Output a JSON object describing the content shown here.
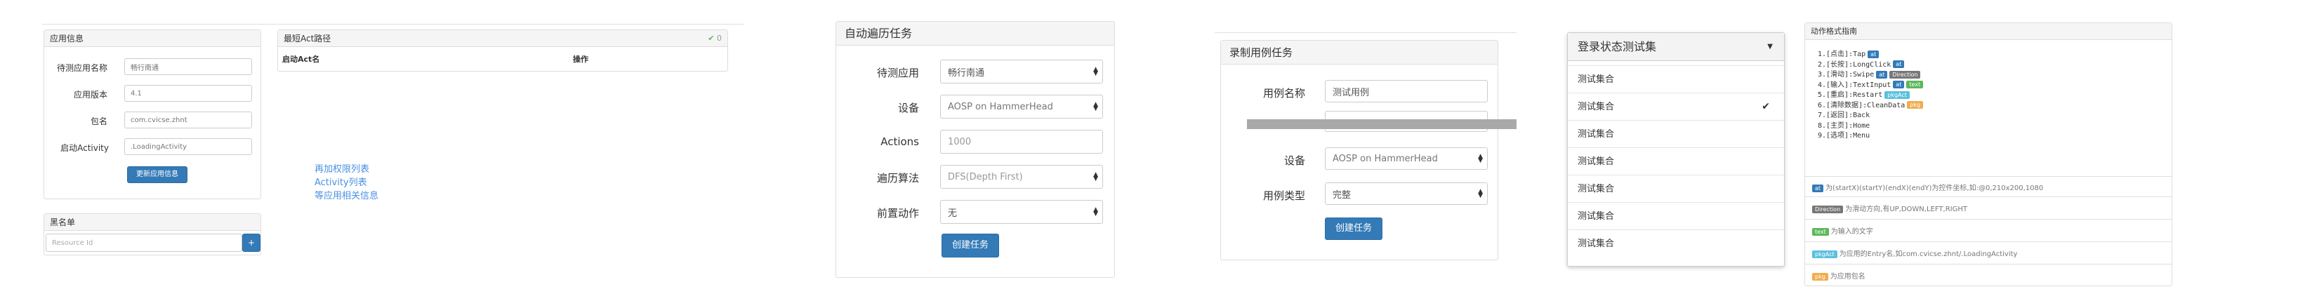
{
  "app_info": {
    "title": "应用信息",
    "fields": [
      {
        "label": "待测应用名称",
        "value": "畅行南通"
      },
      {
        "label": "应用版本",
        "value": "4.1"
      },
      {
        "label": "包名",
        "value": "com.cvicse.zhnt"
      },
      {
        "label": "启动Activity",
        "value": ".LoadingActivity"
      }
    ],
    "update_button": "更新应用信息"
  },
  "blacklist": {
    "title": "黑名单",
    "placeholder": "Resource Id",
    "add_button": "+"
  },
  "shortest_path": {
    "title": "最短Act路径",
    "count": "0",
    "col_start": "启动Act名",
    "col_op": "操作"
  },
  "links": [
    "再加权限列表",
    "Activity列表",
    "等应用相关信息"
  ],
  "auto_traverse": {
    "title": "自动遍历任务",
    "fields": [
      {
        "label": "待测应用",
        "value": "畅行南通",
        "type": "select"
      },
      {
        "label": "设备",
        "value": "AOSP on HammerHead",
        "type": "select"
      },
      {
        "label": "Actions",
        "value": "1000",
        "type": "input"
      },
      {
        "label": "遍历算法",
        "value": "DFS(Depth First)",
        "type": "select"
      },
      {
        "label": "前置动作",
        "value": "无",
        "type": "select"
      }
    ],
    "create_button": "创建任务"
  },
  "record_case": {
    "title": "录制用例任务",
    "fields": [
      {
        "label": "用例名称",
        "value": "测试用例",
        "type": "input"
      },
      {
        "label": "",
        "value": "",
        "type": "input"
      },
      {
        "label": "设备",
        "value": "AOSP on HammerHead",
        "type": "select"
      },
      {
        "label": "用例类型",
        "value": "完整",
        "type": "select"
      }
    ],
    "create_button": "创建任务"
  },
  "test_set_dropdown": {
    "selected": "登录状态测试集",
    "items": [
      "测试集合",
      "测试集合",
      "测试集合",
      "测试集合",
      "测试集合",
      "测试集合",
      "测试集合"
    ],
    "checked_index": 1
  },
  "action_format": {
    "title": "动作格式指南",
    "lines": [
      {
        "text": "1.[点击]:Tap",
        "badges": [
          {
            "t": "at",
            "c": "blue"
          }
        ]
      },
      {
        "text": "2.[长按]:LongClick",
        "badges": [
          {
            "t": "at",
            "c": "blue"
          }
        ]
      },
      {
        "text": "3.[滑动]:Swipe",
        "badges": [
          {
            "t": "at",
            "c": "blue"
          },
          {
            "t": "Direction",
            "c": "gray"
          }
        ]
      },
      {
        "text": "4.[输入]:TextInput",
        "badges": [
          {
            "t": "at",
            "c": "blue"
          },
          {
            "t": "text",
            "c": "green"
          }
        ]
      },
      {
        "text": "5.[重启]:Restart",
        "badges": [
          {
            "t": "pkgAct",
            "c": "cyan"
          }
        ]
      },
      {
        "text": "6.[清除数据]:CleanData",
        "badges": [
          {
            "t": "pkg",
            "c": "orange"
          }
        ]
      },
      {
        "text": "7.[返回]:Back",
        "badges": []
      },
      {
        "text": "8.[主页]:Home",
        "badges": []
      },
      {
        "text": "9.[选项]:Menu",
        "badges": []
      }
    ],
    "notes": [
      {
        "badge": "at",
        "c": "blue",
        "text": "为(startX)(startY)(endX)(endY)为控件坐标,如:@0,210x200,1080"
      },
      {
        "badge": "Direction",
        "c": "gray",
        "text": "为滑动方向,有UP,DOWN,LEFT,RIGHT"
      },
      {
        "badge": "text",
        "c": "green",
        "text": "为输入的文字"
      },
      {
        "badge": "pkgAct",
        "c": "cyan",
        "text": "为应用的Entry名,如com.cvicse.zhnt/.LoadingActivity"
      },
      {
        "badge": "pkg",
        "c": "orange",
        "text": "为应用包名"
      }
    ]
  },
  "colors": {
    "primary": "#337ab7",
    "link": "#4a90e2",
    "success_check": "#5cb85c"
  }
}
